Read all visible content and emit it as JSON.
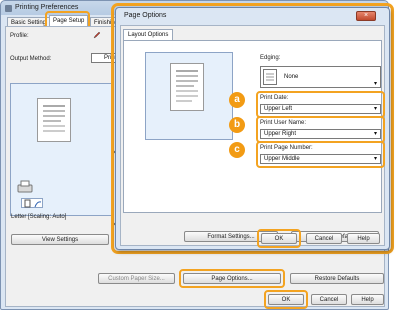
{
  "background_dialog": {
    "title": "Printing Preferences",
    "tabs": [
      "Basic Setting",
      "Page Setup",
      "Finishing",
      "Q"
    ],
    "profile_label": "Profile:",
    "output_method_label": "Output Method:",
    "output_method_value": "Print",
    "letter_scaling": "Letter [Scaling: Auto]",
    "view_settings": "View Settings",
    "custom_paper_size": "Custom Paper Size...",
    "page_options": "Page Options...",
    "restore_defaults": "Restore Defaults",
    "ok": "OK",
    "cancel": "Cancel",
    "help": "Help",
    "partial_letters": [
      "P",
      "P"
    ]
  },
  "page_options_dialog": {
    "title": "Page Options",
    "close_glyph": "×",
    "tab": "Layout Options",
    "edging_label": "Edging:",
    "edging_value": "None",
    "print_date_label": "Print Date:",
    "print_date_value": "Upper Left",
    "print_user_name_label": "Print User Name:",
    "print_user_name_value": "Upper Right",
    "print_page_number_label": "Print Page Number:",
    "print_page_number_value": "Upper Middle",
    "format_settings": "Format Settings...",
    "restore_defaults": "Restore Defaults",
    "ok": "OK",
    "cancel": "Cancel",
    "help": "Help"
  },
  "badges": {
    "a": "a",
    "b": "b",
    "c": "c"
  },
  "colors": {
    "highlight": "#f3a321",
    "badge": "#f29b14",
    "window": "#dbe6f3"
  }
}
